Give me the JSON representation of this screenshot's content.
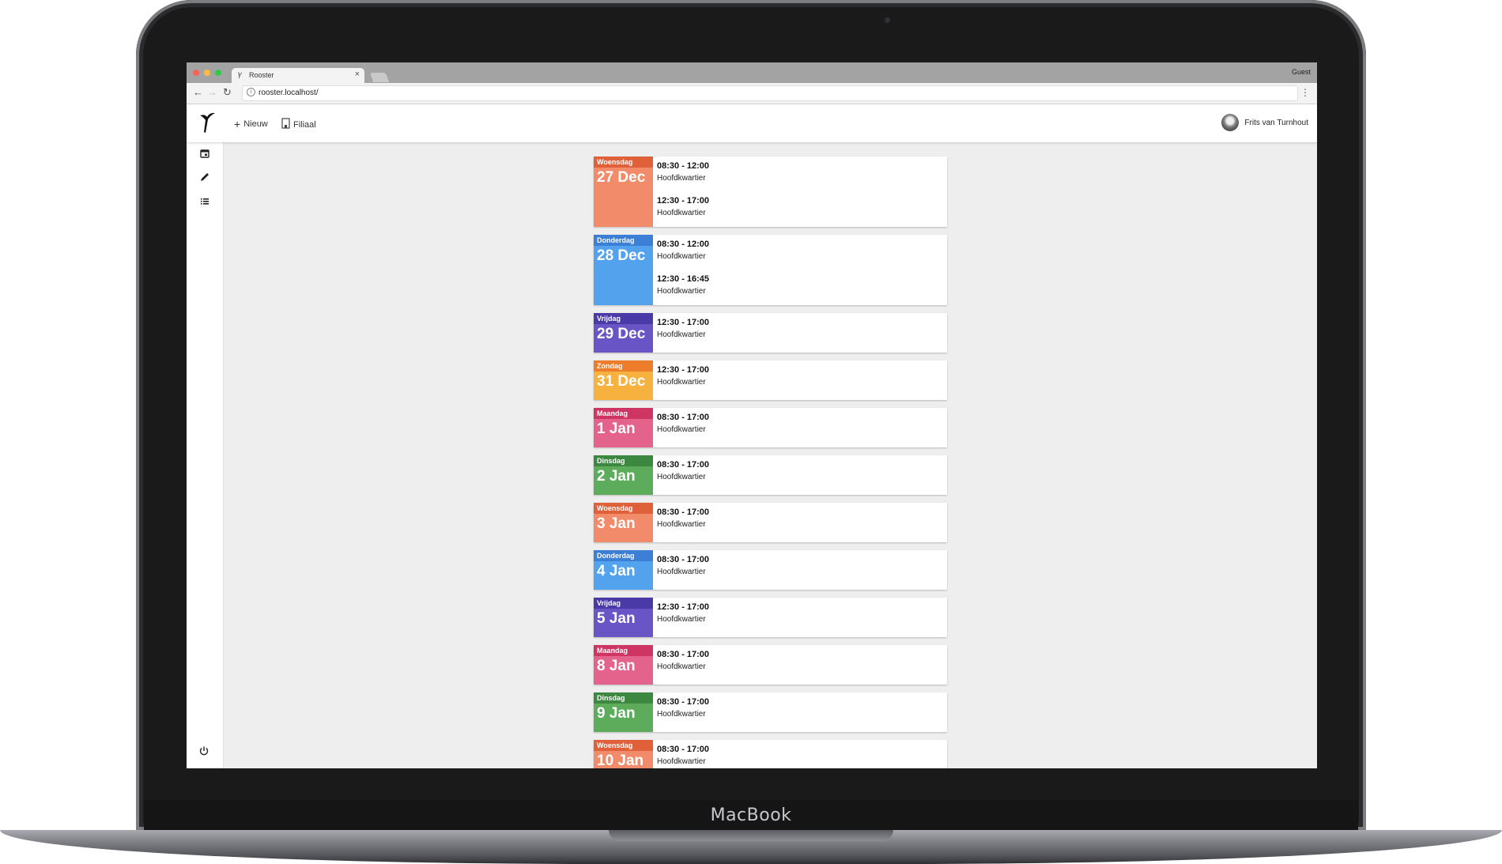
{
  "device": {
    "brand": "MacBook"
  },
  "browser": {
    "tab_title": "Rooster",
    "tab_close": "×",
    "profile": "Guest",
    "url": "rooster.localhost/",
    "kebab": "⋮"
  },
  "header": {
    "new_icon": "+",
    "new_label": "Nieuw",
    "branch_label": "Filiaal",
    "user_name": "Frits van Turnhout"
  },
  "sidebar": {
    "items": [
      {
        "name": "calendar-icon"
      },
      {
        "name": "pencil-icon"
      },
      {
        "name": "list-icon"
      }
    ],
    "footer": {
      "name": "power-icon"
    }
  },
  "colors": {
    "orange": {
      "top": "#e0603a",
      "body": "#f28b6a"
    },
    "blue": {
      "top": "#3b7fd6",
      "body": "#53a2ee"
    },
    "purple": {
      "top": "#4a3aa8",
      "body": "#6a55c7"
    },
    "amber": {
      "top": "#ee7d2b",
      "body": "#f6b13f"
    },
    "pink": {
      "top": "#cf3563",
      "body": "#e3638d"
    },
    "green": {
      "top": "#3c8840",
      "body": "#5cac5c"
    }
  },
  "schedule": [
    {
      "weekday": "Woensdag",
      "date": "27 Dec",
      "color": "orange",
      "shifts": [
        {
          "time": "08:30 - 12:00",
          "location": "Hoofdkwartier"
        },
        {
          "time": "12:30 - 17:00",
          "location": "Hoofdkwartier"
        }
      ]
    },
    {
      "weekday": "Donderdag",
      "date": "28 Dec",
      "color": "blue",
      "shifts": [
        {
          "time": "08:30 - 12:00",
          "location": "Hoofdkwartier"
        },
        {
          "time": "12:30 - 16:45",
          "location": "Hoofdkwartier"
        }
      ]
    },
    {
      "weekday": "Vrijdag",
      "date": "29 Dec",
      "color": "purple",
      "shifts": [
        {
          "time": "12:30 - 17:00",
          "location": "Hoofdkwartier"
        }
      ]
    },
    {
      "weekday": "Zondag",
      "date": "31 Dec",
      "color": "amber",
      "shifts": [
        {
          "time": "12:30 - 17:00",
          "location": "Hoofdkwartier"
        }
      ]
    },
    {
      "weekday": "Maandag",
      "date": "1 Jan",
      "color": "pink",
      "shifts": [
        {
          "time": "08:30 - 17:00",
          "location": "Hoofdkwartier"
        }
      ]
    },
    {
      "weekday": "Dinsdag",
      "date": "2 Jan",
      "color": "green",
      "shifts": [
        {
          "time": "08:30 - 17:00",
          "location": "Hoofdkwartier"
        }
      ]
    },
    {
      "weekday": "Woensdag",
      "date": "3 Jan",
      "color": "orange",
      "shifts": [
        {
          "time": "08:30 - 17:00",
          "location": "Hoofdkwartier"
        }
      ]
    },
    {
      "weekday": "Donderdag",
      "date": "4 Jan",
      "color": "blue",
      "shifts": [
        {
          "time": "08:30 - 17:00",
          "location": "Hoofdkwartier"
        }
      ]
    },
    {
      "weekday": "Vrijdag",
      "date": "5 Jan",
      "color": "purple",
      "shifts": [
        {
          "time": "12:30 - 17:00",
          "location": "Hoofdkwartier"
        }
      ]
    },
    {
      "weekday": "Maandag",
      "date": "8 Jan",
      "color": "pink",
      "shifts": [
        {
          "time": "08:30 - 17:00",
          "location": "Hoofdkwartier"
        }
      ]
    },
    {
      "weekday": "Dinsdag",
      "date": "9 Jan",
      "color": "green",
      "shifts": [
        {
          "time": "08:30 - 17:00",
          "location": "Hoofdkwartier"
        }
      ]
    },
    {
      "weekday": "Woensdag",
      "date": "10 Jan",
      "color": "orange",
      "shifts": [
        {
          "time": "08:30 - 17:00",
          "location": "Hoofdkwartier"
        }
      ]
    }
  ]
}
